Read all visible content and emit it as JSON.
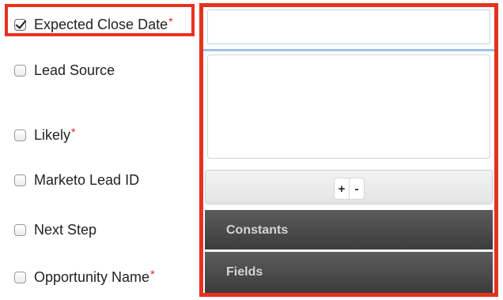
{
  "fields": [
    {
      "label": "Expected Close Date",
      "required": "*",
      "checked": true
    },
    {
      "label": "Lead Source",
      "required": "",
      "checked": false
    },
    {
      "label": "Likely",
      "required": "*",
      "checked": false
    },
    {
      "label": "Marketo Lead ID",
      "required": "",
      "checked": false
    },
    {
      "label": "Next Step",
      "required": "",
      "checked": false
    },
    {
      "label": "Opportunity Name",
      "required": "*",
      "checked": false
    }
  ],
  "builder": {
    "formula_input_value": "",
    "formula_text_value": "",
    "add_label": "+",
    "remove_label": "-",
    "constants_label": "Constants",
    "fields_label": "Fields"
  },
  "colors": {
    "highlight": "#e7321f",
    "required_asterisk": "#e0201a",
    "section_header": "#4a4a4a"
  }
}
